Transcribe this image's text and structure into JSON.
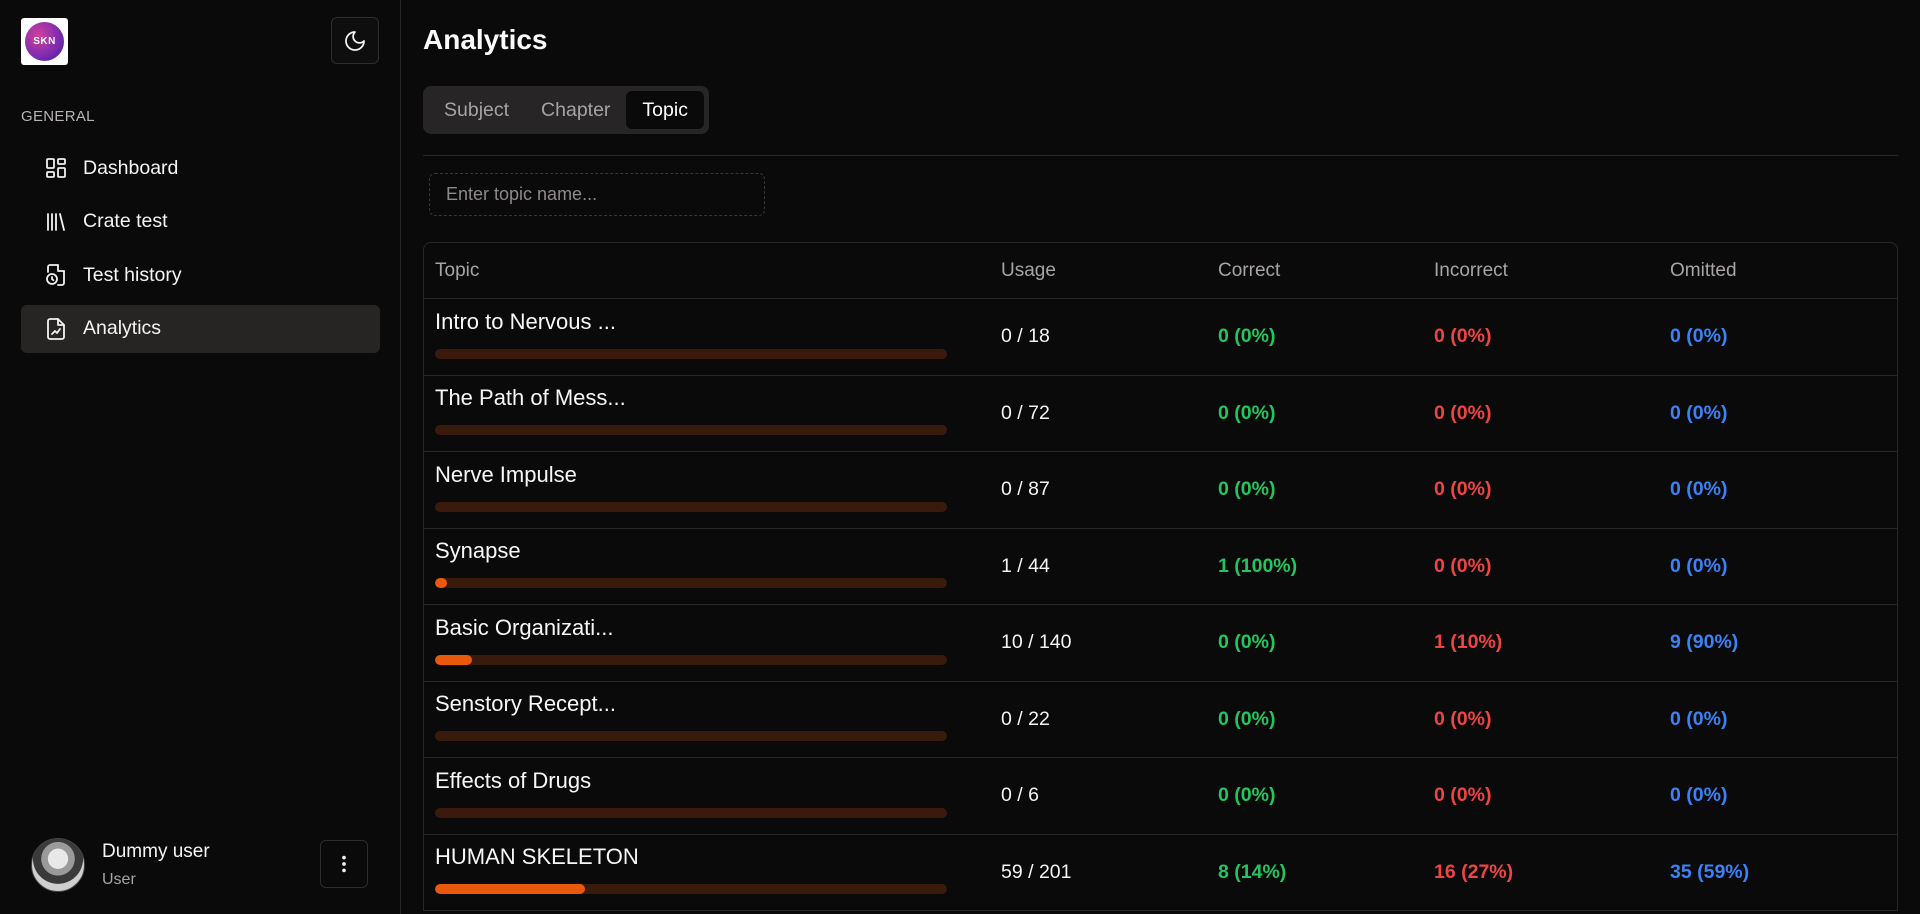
{
  "logo": {
    "text": "SKN"
  },
  "sidebar": {
    "section_label": "GENERAL",
    "items": [
      {
        "label": "Dashboard",
        "icon": "dashboard-icon",
        "active": false
      },
      {
        "label": "Crate test",
        "icon": "library-icon",
        "active": false
      },
      {
        "label": "Test history",
        "icon": "file-clock-icon",
        "active": false
      },
      {
        "label": "Analytics",
        "icon": "file-chart-icon",
        "active": true
      }
    ]
  },
  "user": {
    "name": "Dummy user",
    "role": "User"
  },
  "header": {
    "title": "Analytics"
  },
  "tabs": [
    {
      "label": "Subject",
      "active": false
    },
    {
      "label": "Chapter",
      "active": false
    },
    {
      "label": "Topic",
      "active": true
    }
  ],
  "search": {
    "placeholder": "Enter topic name..."
  },
  "table": {
    "headers": {
      "topic": "Topic",
      "usage": "Usage",
      "correct": "Correct",
      "incorrect": "Incorrect",
      "omitted": "Omitted"
    },
    "rows": [
      {
        "topic": "Intro to Nervous ...",
        "usage": "0 / 18",
        "progress": 0.0,
        "correct": "0 (0%)",
        "incorrect": "0 (0%)",
        "omitted": "0 (0%)"
      },
      {
        "topic": "The Path of Mess...",
        "usage": "0 / 72",
        "progress": 0.0,
        "correct": "0 (0%)",
        "incorrect": "0 (0%)",
        "omitted": "0 (0%)"
      },
      {
        "topic": "Nerve Impulse",
        "usage": "0 / 87",
        "progress": 0.0,
        "correct": "0 (0%)",
        "incorrect": "0 (0%)",
        "omitted": "0 (0%)"
      },
      {
        "topic": "Synapse",
        "usage": "1 / 44",
        "progress": 0.0227,
        "correct": "1 (100%)",
        "incorrect": "0 (0%)",
        "omitted": "0 (0%)"
      },
      {
        "topic": "Basic Organizati...",
        "usage": "10 / 140",
        "progress": 0.0714,
        "correct": "0 (0%)",
        "incorrect": "1 (10%)",
        "omitted": "9 (90%)"
      },
      {
        "topic": "Senstory Recept...",
        "usage": "0 / 22",
        "progress": 0.0,
        "correct": "0 (0%)",
        "incorrect": "0 (0%)",
        "omitted": "0 (0%)"
      },
      {
        "topic": "Effects of Drugs",
        "usage": "0 / 6",
        "progress": 0.0,
        "correct": "0 (0%)",
        "incorrect": "0 (0%)",
        "omitted": "0 (0%)"
      },
      {
        "topic": "HUMAN SKELETON",
        "usage": "59 / 201",
        "progress": 0.2935,
        "correct": "8 (14%)",
        "incorrect": "16 (27%)",
        "omitted": "35 (59%)"
      }
    ]
  },
  "colors": {
    "accent": "#ea580c",
    "correct": "#22c55e",
    "incorrect": "#ef4444",
    "omitted": "#3b82f6"
  }
}
